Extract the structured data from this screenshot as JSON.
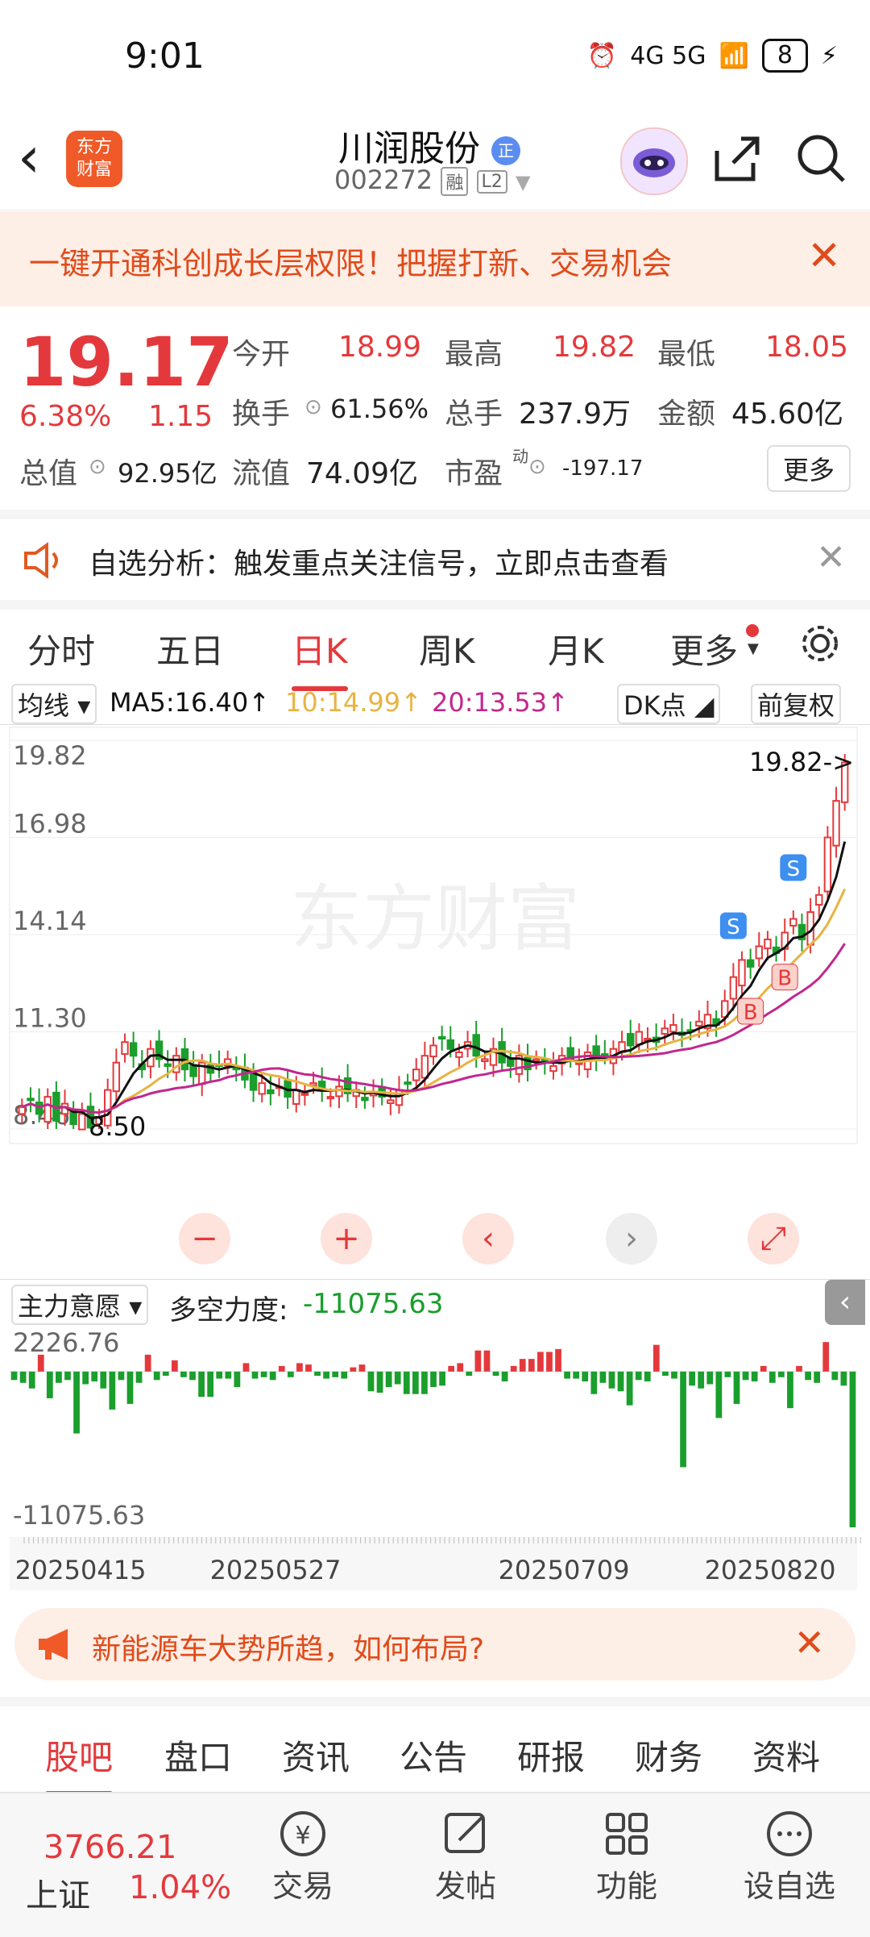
{
  "status_bar": {
    "time": "9:01",
    "network": "4G 5G",
    "battery": "8"
  },
  "header": {
    "logo_line1": "东方",
    "logo_line2": "财富",
    "stock_name": "川润股份",
    "badge": "正",
    "stock_code": "002272",
    "tag_rong": "融",
    "tag_l2": "L2"
  },
  "banner": {
    "text": "一键开通科创成长层权限！把握打新、交易机会"
  },
  "quote": {
    "price": "19.17",
    "change_pct": "6.38%",
    "change": "1.15",
    "open_label": "今开",
    "open": "18.99",
    "high_label": "最高",
    "high": "19.82",
    "low_label": "最低",
    "low": "18.05",
    "turnover_label": "换手",
    "turnover": "61.56%",
    "volume_label": "总手",
    "volume": "237.9万",
    "amount_label": "金额",
    "amount": "45.60亿",
    "mktcap_label": "总值",
    "mktcap": "92.95亿",
    "float_label": "流值",
    "float": "74.09亿",
    "pe_label": "市盈",
    "pe_sup": "动",
    "pe": "-197.17",
    "more": "更多"
  },
  "analysis": {
    "text": "自选分析：触发重点关注信号，立即点击查看"
  },
  "kline_tabs": [
    {
      "label": "分时"
    },
    {
      "label": "五日"
    },
    {
      "label": "日K"
    },
    {
      "label": "周K"
    },
    {
      "label": "月K"
    },
    {
      "label": "更多"
    }
  ],
  "ma": {
    "selector": "均线",
    "ma5": "MA5:16.40↑",
    "ma10": "10:14.99↑",
    "ma20": "20:13.53↑",
    "dk": "DK点",
    "adjust": "前复权"
  },
  "colors": {
    "up": "#e4393c",
    "down": "#1a9e2c",
    "ma5": "#111111",
    "ma10": "#e8b342",
    "ma20": "#c2278f"
  },
  "chart_data": [
    {
      "type": "candlestick",
      "title": "",
      "y_ticks": [
        "19.82",
        "16.98",
        "14.14",
        "11.30",
        "8.46"
      ],
      "ylim": [
        8.46,
        19.82
      ],
      "max_marker": "19.82->",
      "min_marker": "8.50",
      "signals": [
        "S",
        "S",
        "B",
        "B"
      ],
      "watermark": "东方财富",
      "series": [
        {
          "name": "MA5"
        },
        {
          "name": "MA10"
        },
        {
          "name": "MA20"
        }
      ],
      "close_approx": [
        9.1,
        9.3,
        8.9,
        9.4,
        8.7,
        9.2,
        8.6,
        8.9,
        8.5,
        8.8,
        9.6,
        10.4,
        11.0,
        10.6,
        10.2,
        10.8,
        10.5,
        10.3,
        10.6,
        10.2,
        10.0,
        10.4,
        10.1,
        10.3,
        10.5,
        10.2,
        9.9,
        9.6,
        9.8,
        9.5,
        9.7,
        9.4,
        9.6,
        9.5,
        9.8,
        9.6,
        9.4,
        9.7,
        9.5,
        9.6,
        9.3,
        9.5,
        9.4,
        9.3,
        9.6,
        9.8,
        10.2,
        10.6,
        10.9,
        11.1,
        10.8,
        10.7,
        11.0,
        10.6,
        10.5,
        10.8,
        10.4,
        10.3,
        10.6,
        10.2,
        10.5,
        10.4,
        10.3,
        10.6,
        10.5,
        10.4,
        10.7,
        10.5,
        10.6,
        10.8,
        11.0,
        10.9,
        11.3,
        11.1,
        11.0,
        11.4,
        11.5,
        11.2,
        11.3,
        11.6,
        11.8,
        11.5,
        12.2,
        12.9,
        13.4,
        13.2,
        13.8,
        14.0,
        13.6,
        14.2,
        14.6,
        14.0,
        14.8,
        15.3,
        16.98,
        18.05,
        19.17
      ]
    },
    {
      "type": "bar",
      "title": "",
      "indicator": "主力意愿",
      "indicator_label": "多空力度:",
      "indicator_value": "-11075.63",
      "y_ticks": [
        "2226.76",
        "-11075.63"
      ],
      "ylim": [
        -11075.63,
        2226.76
      ],
      "x_ticks": [
        "20250415",
        "20250527",
        "20250709",
        "20250820"
      ],
      "values": [
        -600,
        -800,
        -1200,
        1200,
        -1900,
        -800,
        -600,
        -4400,
        -900,
        -700,
        -1200,
        -2700,
        -600,
        -2300,
        -800,
        1200,
        -600,
        -300,
        800,
        -400,
        -600,
        -1800,
        -1800,
        -500,
        -500,
        -1100,
        600,
        -500,
        -400,
        -600,
        400,
        -400,
        600,
        500,
        -300,
        -500,
        -400,
        -500,
        300,
        500,
        -1400,
        -1500,
        -1100,
        -900,
        -1600,
        -1600,
        -1600,
        -1100,
        -1000,
        400,
        600,
        -300,
        1500,
        1500,
        -300,
        -700,
        400,
        900,
        900,
        1400,
        1400,
        1600,
        -500,
        -500,
        -700,
        -1600,
        -800,
        -1200,
        -1400,
        -2400,
        -600,
        -700,
        1900,
        -300,
        -500,
        -6800,
        -1000,
        -1200,
        -900,
        -3300,
        -400,
        -2300,
        -600,
        -700,
        400,
        -800,
        -400,
        -2600,
        400,
        -600,
        -800,
        2100,
        -600,
        -1000,
        -11075.63
      ]
    }
  ],
  "ad": {
    "text": "新能源车大势所趋，如何布局?"
  },
  "bottom_tabs": [
    {
      "label": "股吧"
    },
    {
      "label": "盘口"
    },
    {
      "label": "资讯"
    },
    {
      "label": "公告"
    },
    {
      "label": "研报"
    },
    {
      "label": "财务"
    },
    {
      "label": "资料"
    }
  ],
  "bottom_bar": {
    "index_value": "3766.21",
    "index_name": "上证",
    "index_change": "1.04%",
    "items": [
      {
        "label": "交易"
      },
      {
        "label": "发帖"
      },
      {
        "label": "功能"
      },
      {
        "label": "设自选"
      }
    ]
  }
}
